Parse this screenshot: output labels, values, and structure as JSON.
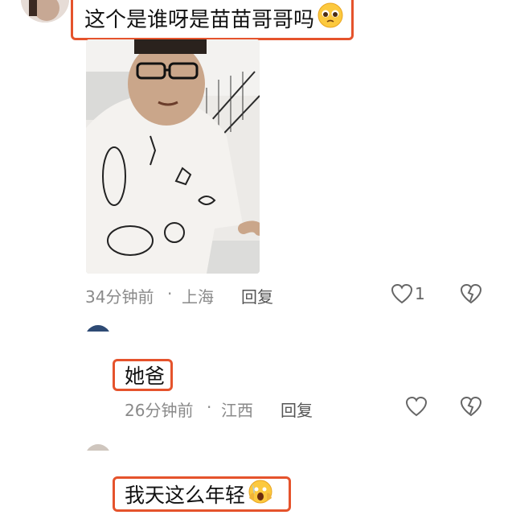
{
  "comments": [
    {
      "text": "这个是谁呀是苗苗哥哥吗",
      "emoji": "pleading-face",
      "time": "34分钟前",
      "sep": "·",
      "location": "上海",
      "reply_label": "回复",
      "like_count": "1"
    },
    {
      "text": "她爸",
      "time": "26分钟前",
      "sep": "·",
      "location": "江西",
      "reply_label": "回复"
    },
    {
      "text": "我天这么年轻",
      "emoji": "screaming-face"
    }
  ],
  "colors": {
    "highlight": "#e5532c",
    "meta_text": "#8a8a8a"
  }
}
